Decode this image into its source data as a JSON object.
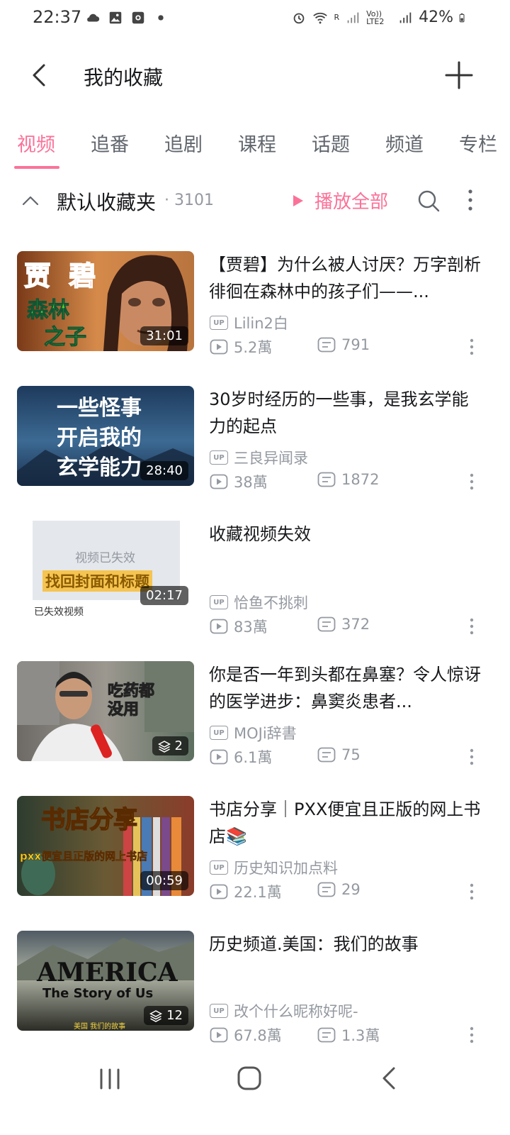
{
  "status_bar": {
    "time": "22:37",
    "battery": "42%",
    "signal_r": "R",
    "signal_volte": "Vo)) LTE2"
  },
  "header": {
    "title": "我的收藏"
  },
  "tabs": [
    "视频",
    "追番",
    "追剧",
    "课程",
    "话题",
    "频道",
    "专栏"
  ],
  "folder": {
    "name": "默认收藏夹",
    "count": "· 3101",
    "play_all": "播放全部"
  },
  "colors": {
    "accent": "#fb7299",
    "secondary_text": "#9499a0"
  },
  "up_badge": "UP",
  "videos": [
    {
      "title": "【贾碧】为什么被人讨厌？万字剖析徘徊在森林中的孩子们——...",
      "uploader": "Lilin2白",
      "views": "5.2萬",
      "danmaku": "791",
      "duration": "31:01",
      "thumb_text": [
        "贾 碧",
        "森林",
        "之子"
      ]
    },
    {
      "title": "30岁时经历的一些事，是我玄学能力的起点",
      "uploader": "三良异闻录",
      "views": "38萬",
      "danmaku": "1872",
      "duration": "28:40",
      "thumb_text": [
        "一些怪事",
        "开启我的",
        "玄学能力"
      ]
    },
    {
      "title": "收藏视频失效",
      "uploader": "恰鱼不挑刺",
      "views": "83萬",
      "danmaku": "372",
      "duration": "02:17",
      "thumb_text": [
        "视频已失效",
        "找回封面和标题",
        "已失效视频"
      ]
    },
    {
      "title": "你是否一年到头都在鼻塞？令人惊讶的医学进步：鼻窦炎患者...",
      "uploader": "MOJi辞書",
      "views": "6.1萬",
      "danmaku": "75",
      "duration": "2",
      "thumb_text": [
        "吃药都",
        "没用"
      ]
    },
    {
      "title": "书店分享｜PXX便宜且正版的网上书店📚",
      "uploader": "历史知识加点料",
      "views": "22.1萬",
      "danmaku": "29",
      "duration": "00:59",
      "thumb_text": [
        "书店分享",
        "pxx便宜且正版的网上书店"
      ]
    },
    {
      "title": "历史频道.美国：我们的故事",
      "uploader": "改个什么昵称好呢-",
      "views": "67.8萬",
      "danmaku": "1.3萬",
      "duration": "12",
      "thumb_text": [
        "AMERICA",
        "The Story of Us",
        "美国 我们的故事"
      ]
    }
  ]
}
